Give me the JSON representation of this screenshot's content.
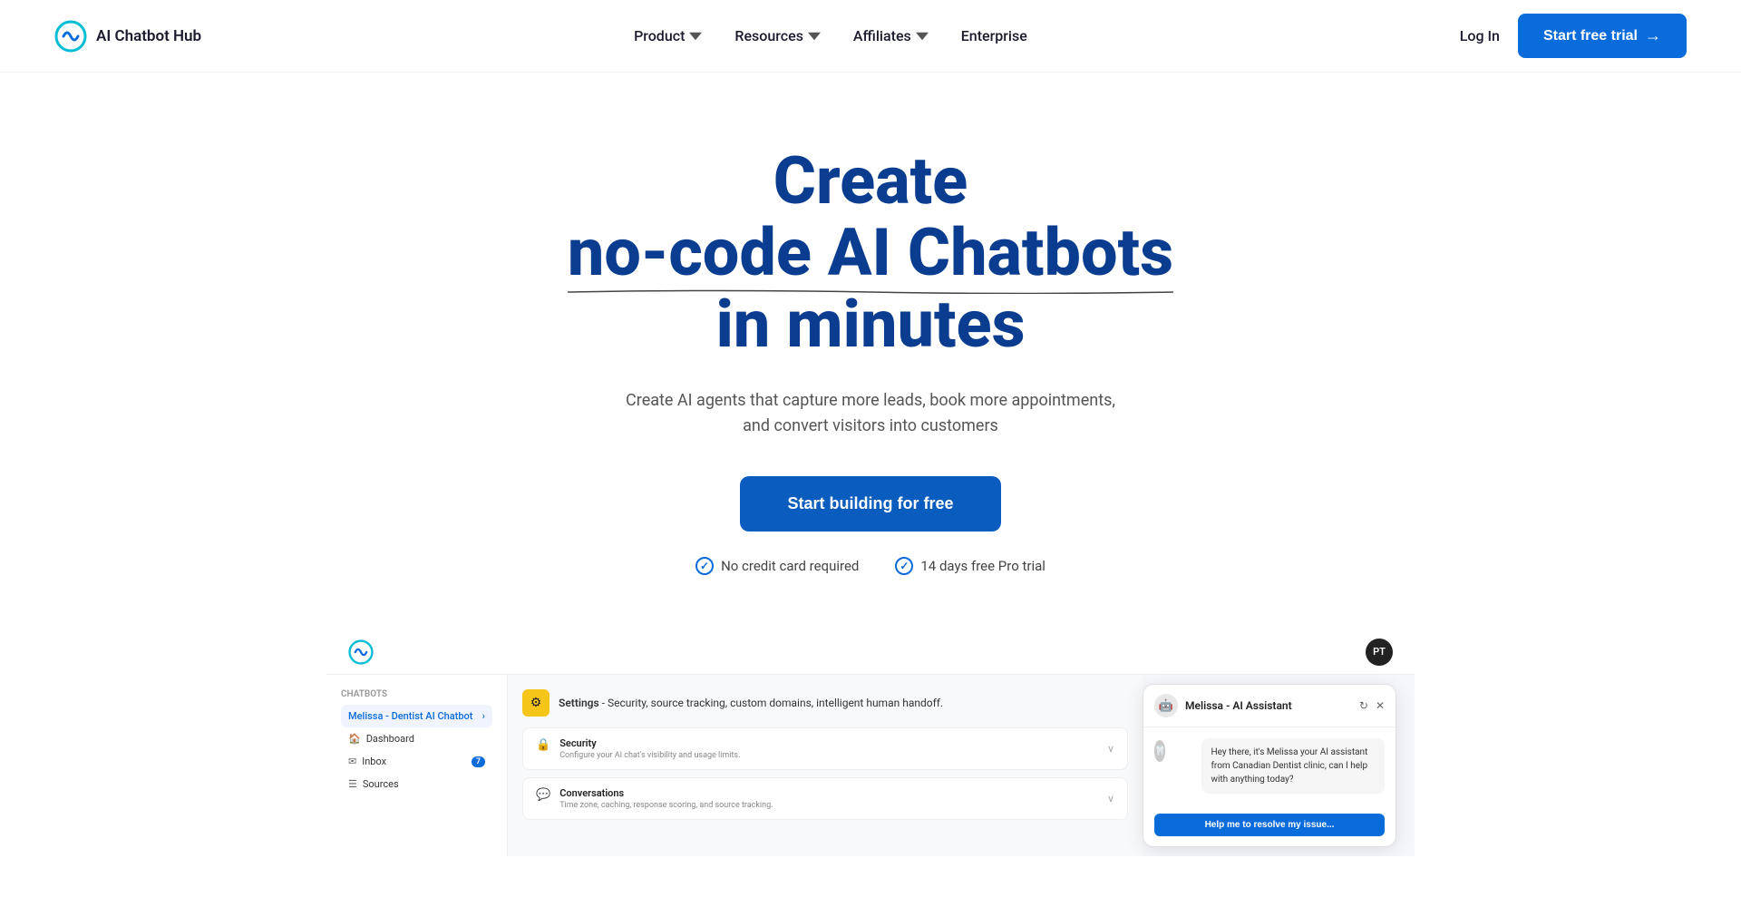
{
  "nav": {
    "logo_text": "AI Chatbot Hub",
    "links": [
      {
        "label": "Product",
        "has_dropdown": true
      },
      {
        "label": "Resources",
        "has_dropdown": true
      },
      {
        "label": "Affiliates",
        "has_dropdown": true
      },
      {
        "label": "Enterprise",
        "has_dropdown": false
      }
    ],
    "login_label": "Log In",
    "cta_label": "Start free trial",
    "cta_arrow": "→"
  },
  "hero": {
    "title_line1": "Create ",
    "title_highlight": "no-code AI Chatbots",
    "title_line2": "in minutes",
    "subtitle": "Create AI agents that capture more leads, book more appointments, and convert visitors into customers",
    "cta_label": "Start building for free",
    "badge1": "No credit card required",
    "badge2": "14 days free Pro trial"
  },
  "preview": {
    "topbar_avatar": "PT",
    "sidebar": {
      "section_label": "Chatbots",
      "active_item": "Melissa - Dentist AI Chatbot",
      "items": [
        {
          "icon": "🏠",
          "label": "Dashboard",
          "badge": ""
        },
        {
          "icon": "✉",
          "label": "Inbox",
          "badge": "7"
        },
        {
          "icon": "☰",
          "label": "Sources",
          "badge": ""
        }
      ]
    },
    "settings": {
      "icon": "⚙",
      "title": "Settings",
      "subtitle": "Security, source tracking, custom domains, intelligent human handoff.",
      "cards": [
        {
          "icon": "🔒",
          "title": "Security",
          "desc": "Configure your AI chat's visibility and usage limits."
        },
        {
          "icon": "💬",
          "title": "Conversations",
          "desc": "Time zone, caching, response scoring, and source tracking."
        }
      ]
    },
    "chatbot": {
      "name": "Melissa - AI Assistant",
      "message": "Hey there, it's Melissa your AI assistant from Canadian Dentist clinic, can I help with anything today?",
      "cta": "Help me to resolve my issue..."
    }
  }
}
